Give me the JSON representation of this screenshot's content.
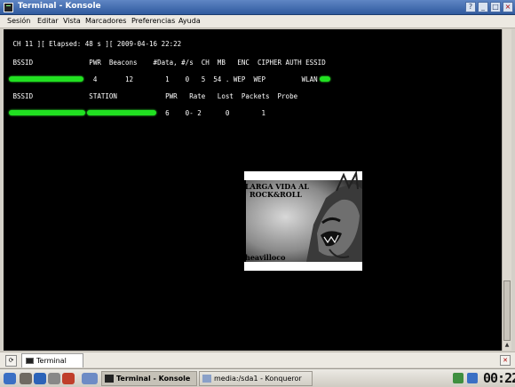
{
  "window": {
    "title": "Terminal - Konsole",
    "buttons": {
      "help": "?",
      "minimize": "_",
      "maximize": "□",
      "close": "×"
    }
  },
  "menu": {
    "items": [
      "Sesión",
      "Editar",
      "Vista",
      "Marcadores",
      "Preferencias",
      "Ayuda"
    ]
  },
  "terminal": {
    "status_line": " CH 11 ][ Elapsed: 48 s ][ 2009-04-16 22:22",
    "ap_header": " BSSID              PWR  Beacons    #Data, #/s  CH  MB   ENC  CIPHER AUTH ESSID",
    "ap_row": "                     4       12        1    0   5  54 . WEP  WEP         WLAN",
    "client_header": " BSSID              STATION            PWR   Rate   Lost  Packets  Probe",
    "client_row": "                                       6    0- 2      0        1"
  },
  "image": {
    "caption_top": "LARGA VIDA AL",
    "caption_mid": "ROCK&ROLL",
    "caption_bottom": "heavilloco"
  },
  "tabs": {
    "items": [
      {
        "label": "Terminal"
      }
    ]
  },
  "taskbar": {
    "tasks": [
      {
        "label": "Terminal - Konsole",
        "active": true
      },
      {
        "label": "media:/sda1 - Konqueror",
        "active": false
      }
    ],
    "clock": "00:22"
  },
  "colors": {
    "titlebar": "#2f5a9e",
    "terminal_bg": "#000000",
    "terminal_fg": "#ffffff",
    "redaction": "#21e021"
  },
  "icons": {
    "app": "konsole-icon",
    "new_tab": "new-tab-icon",
    "close_tab": "close-tab-icon"
  }
}
